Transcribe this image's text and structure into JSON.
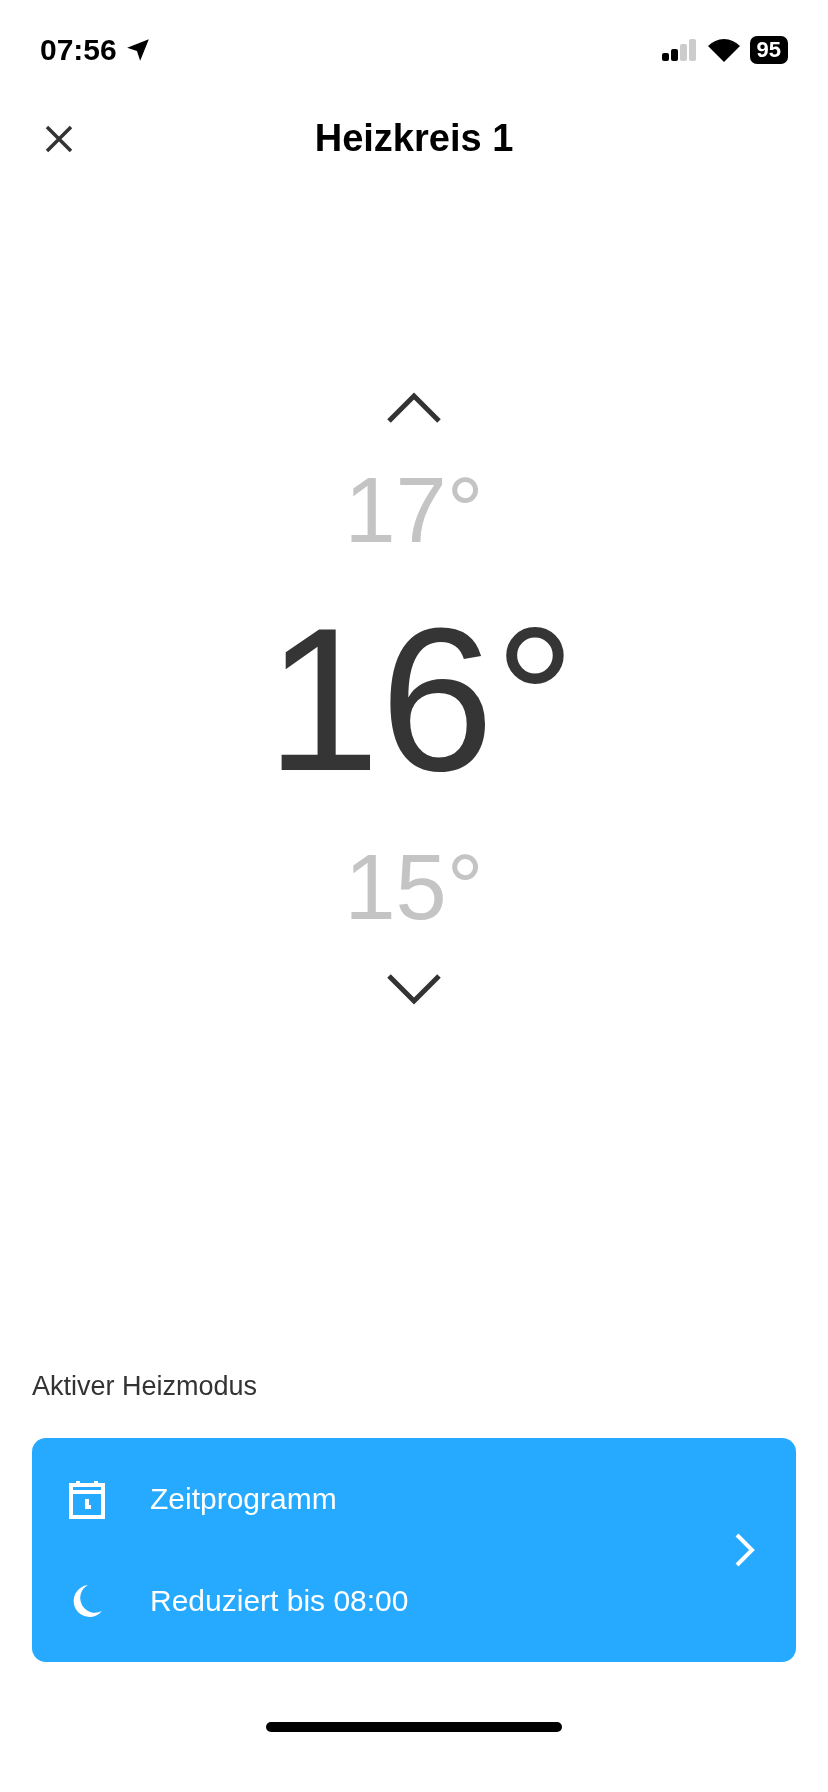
{
  "status_bar": {
    "time": "07:56",
    "battery": "95"
  },
  "header": {
    "title": "Heizkreis 1"
  },
  "temperature_picker": {
    "above": "17°",
    "current": "16°",
    "below": "15°"
  },
  "mode_section": {
    "label": "Aktiver Heizmodus",
    "rows": [
      {
        "kind": "schedule",
        "text": "Zeitprogramm"
      },
      {
        "kind": "reduced",
        "text": "Reduziert bis 08:00"
      }
    ]
  }
}
